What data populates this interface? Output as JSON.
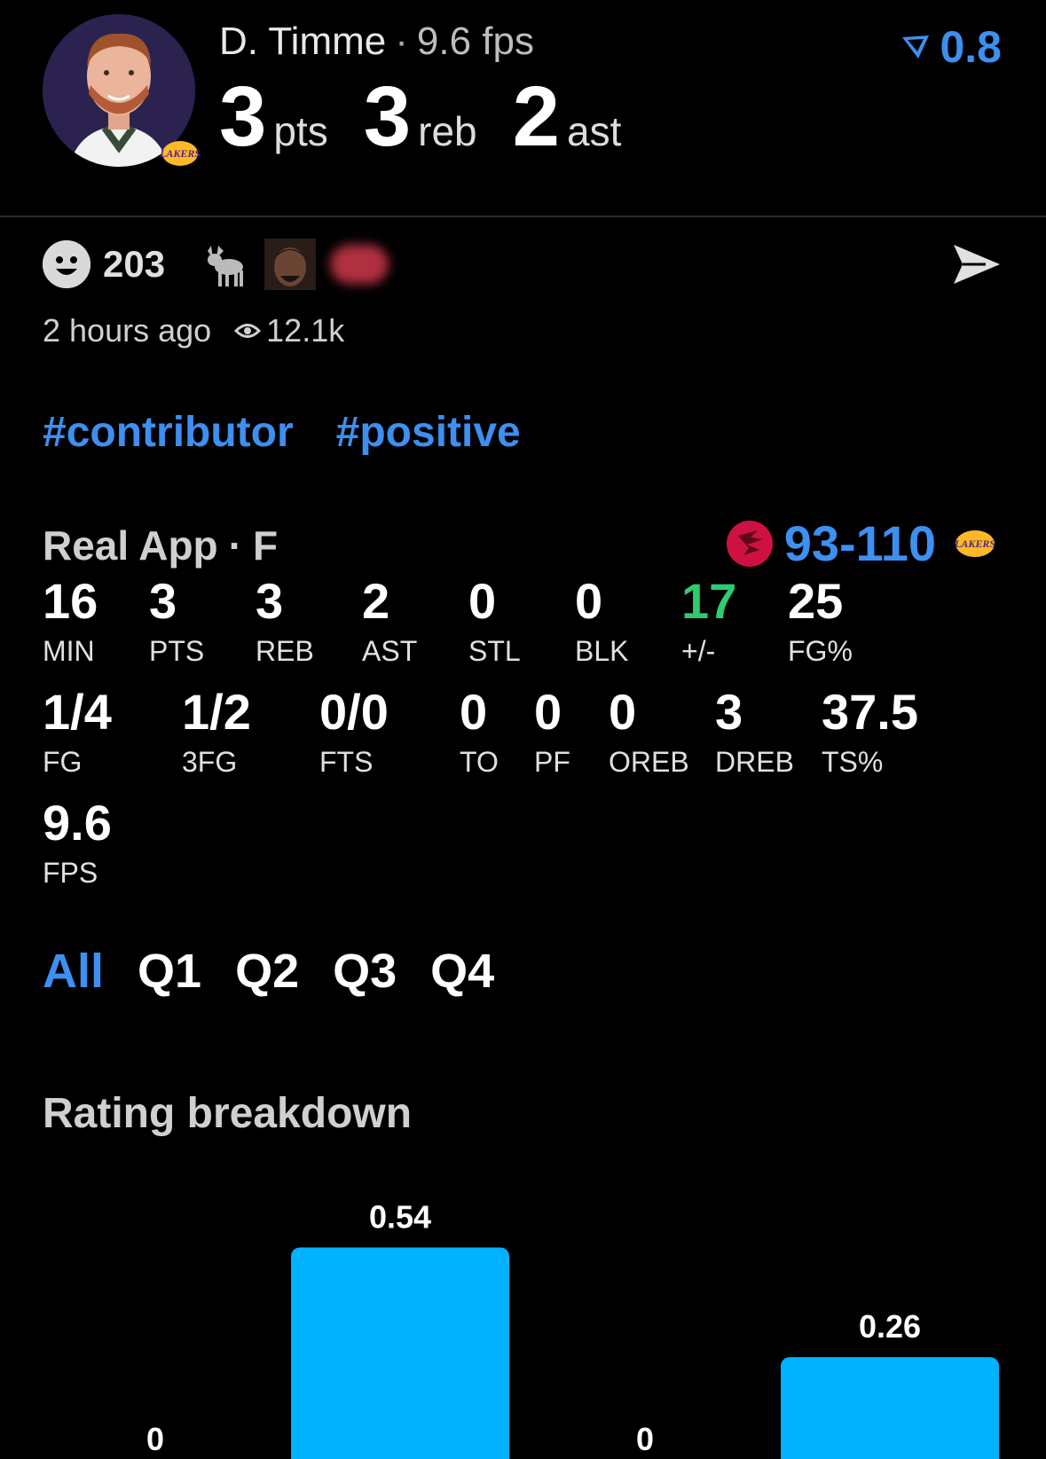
{
  "player": {
    "name": "D. Timme",
    "fps_text": "9.6 fps",
    "pts": "3",
    "pts_unit": "pts",
    "reb": "3",
    "reb_unit": "reb",
    "ast": "2",
    "ast_unit": "ast",
    "team_logo": "lakers-logo"
  },
  "rating": {
    "value": "0.8",
    "icon": "rating-arrow-icon"
  },
  "social": {
    "reaction_icon": "smiley-icon",
    "reaction_count": "203",
    "reactions": [
      "goat-icon",
      "face-avatar",
      "blurred-reaction"
    ],
    "send_icon": "send-icon",
    "posted": "2 hours ago",
    "views_icon": "eye-icon",
    "views": "12.1k"
  },
  "tags": [
    "#contributor",
    "#positive"
  ],
  "game": {
    "source": "Real App",
    "position": "F",
    "score": "93-110",
    "home_logo": "raptors-logo",
    "away_logo": "lakers-logo"
  },
  "stats_row1": [
    {
      "value": "16",
      "label": "MIN"
    },
    {
      "value": "3",
      "label": "PTS"
    },
    {
      "value": "3",
      "label": "REB"
    },
    {
      "value": "2",
      "label": "AST"
    },
    {
      "value": "0",
      "label": "STL"
    },
    {
      "value": "0",
      "label": "BLK"
    },
    {
      "value": "17",
      "label": "+/-"
    },
    {
      "value": "25",
      "label": "FG%"
    }
  ],
  "stats_row2": [
    {
      "value": "1/4",
      "label": "FG"
    },
    {
      "value": "1/2",
      "label": "3FG"
    },
    {
      "value": "0/0",
      "label": "FTS"
    },
    {
      "value": "0",
      "label": "TO"
    },
    {
      "value": "0",
      "label": "PF"
    },
    {
      "value": "0",
      "label": "OREB"
    },
    {
      "value": "3",
      "label": "DREB"
    },
    {
      "value": "37.5",
      "label": "TS%"
    }
  ],
  "stats_row3": [
    {
      "value": "9.6",
      "label": "FPS"
    }
  ],
  "quarter_tabs": [
    "All",
    "Q1",
    "Q2",
    "Q3",
    "Q4"
  ],
  "active_tab": "All",
  "breakdown_title": "Rating breakdown",
  "colors": {
    "accent": "#3d8ff0",
    "bar": "#00b2ff",
    "positive": "#2ecc71"
  },
  "chart_data": {
    "type": "bar",
    "categories": [
      "",
      "",
      "",
      ""
    ],
    "values": [
      0,
      0.54,
      0,
      0.26
    ],
    "labels": [
      "0",
      "0.54",
      "0",
      "0.26"
    ],
    "ylim": [
      0,
      0.6
    ]
  }
}
